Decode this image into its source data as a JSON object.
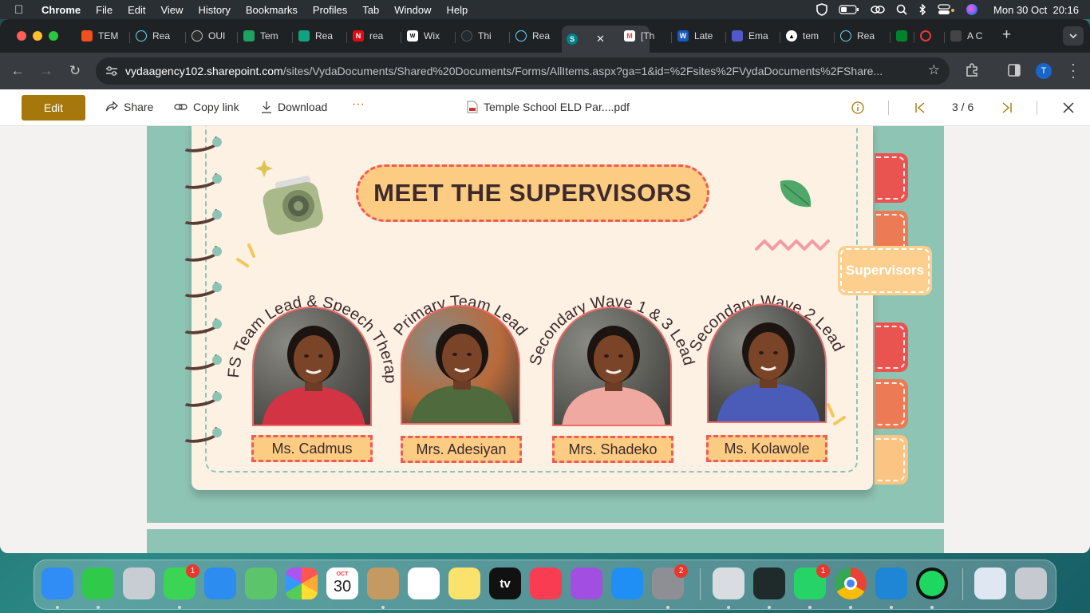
{
  "menubar": {
    "apple_icon": "apple-icon",
    "app_name": "Chrome",
    "menus": [
      "File",
      "Edit",
      "View",
      "History",
      "Bookmarks",
      "Profiles",
      "Tab",
      "Window",
      "Help"
    ],
    "clock": "Mon 30 Oct  20:16"
  },
  "browser": {
    "tabs": [
      {
        "label": "TEM",
        "icon": "figma-icon",
        "color": "#f24e1e"
      },
      {
        "label": "Rea",
        "icon": "react-icon",
        "color": "#61dafb"
      },
      {
        "label": "OUI",
        "icon": "circle-half-icon",
        "color": "#2c2c2c"
      },
      {
        "label": "Tem",
        "icon": "sheets-icon",
        "color": "#1ca261"
      },
      {
        "label": "Rea",
        "icon": "chatgpt-icon",
        "color": "#10a37f"
      },
      {
        "label": "rea",
        "icon": "netflix-icon",
        "color": "#e50914"
      },
      {
        "label": "Wix",
        "icon": "wix-icon",
        "color": "#ffffff"
      },
      {
        "label": "Thi",
        "icon": "github-icon",
        "color": "#24292e"
      },
      {
        "label": "Rea",
        "icon": "react-icon",
        "color": "#61dafb"
      },
      {
        "label": "",
        "icon": "sharepoint-icon",
        "color": "#038387",
        "active": true
      },
      {
        "label": "[Th",
        "icon": "gmail-icon",
        "color": "#ea4335"
      },
      {
        "label": "Late",
        "icon": "word-icon",
        "color": "#185abd"
      },
      {
        "label": "Ema",
        "icon": "teams-icon",
        "color": "#5059c9"
      },
      {
        "label": "tem",
        "icon": "vercel-icon",
        "color": "#000000"
      },
      {
        "label": "Rea",
        "icon": "react-icon",
        "color": "#61dafb"
      },
      {
        "label": "",
        "icon": "google-meet-icon",
        "color": "#00832d"
      },
      {
        "label": "",
        "icon": "record-icon",
        "color": "#e53935"
      },
      {
        "label": "A C",
        "icon": "openai-icon",
        "color": "#444444"
      }
    ],
    "new_tab_label": "+",
    "url_host": "vydaagency102.sharepoint.com",
    "url_path": "/sites/VydaDocuments/Shared%20Documents/Forms/AllItems.aspx?ga=1&id=%2Fsites%2FVydaDocuments%2FShare...",
    "profile_initial": "T"
  },
  "viewer": {
    "edit_label": "Edit",
    "share_label": "Share",
    "copy_link_label": "Copy link",
    "download_label": "Download",
    "more_label": "···",
    "file_name": "Temple School ELD Par....pdf",
    "page_indicator": "3 / 6"
  },
  "slide": {
    "title": "MEET THE SUPERVISORS",
    "side_tab_label": "Supervisors",
    "side_tab_colors": [
      "#e95450",
      "#ec7b55",
      "#e95450",
      "#ec7b55",
      "#fcc483"
    ],
    "supervisors": [
      {
        "role": "EYFS Team Lead & Speech Therapist",
        "name": "Ms. Cadmus",
        "photo_bg": "#5b5a55",
        "shirt": "#d23444"
      },
      {
        "role": "Primary Team Lead",
        "name": "Mrs. Adesiyan",
        "photo_bg": "#b86a3a",
        "shirt": "#4f6a3c"
      },
      {
        "role": "Secondary Wave 1 & 3 Lead",
        "name": "Mrs. Shadeko",
        "photo_bg": "#5d5e58",
        "shirt": "#f0a9a0"
      },
      {
        "role": "Secondary Wave 2 Lead",
        "name": "Ms. Kolawole",
        "photo_bg": "#4f504c",
        "shirt": "#4a5cb8"
      }
    ]
  },
  "dock": {
    "apps": [
      {
        "name": "Finder",
        "icon": "finder-icon",
        "color": "#2f8df5"
      },
      {
        "name": "FaceTime",
        "icon": "facetime-icon",
        "color": "#31c94a"
      },
      {
        "name": "Launchpad",
        "icon": "launchpad-icon",
        "color": "#c8cdd4"
      },
      {
        "name": "Messages",
        "icon": "messages-icon",
        "color": "#3bd454",
        "badge": "1"
      },
      {
        "name": "Mail",
        "icon": "mail-icon",
        "color": "#2d8cf0"
      },
      {
        "name": "Maps",
        "icon": "maps-icon",
        "color": "#5cc46a"
      },
      {
        "name": "Photos",
        "icon": "photos-icon",
        "color": "#ffffff"
      },
      {
        "name": "Calendar",
        "icon": "calendar-icon",
        "color": "#ffffff",
        "month": "OCT",
        "day": "30"
      },
      {
        "name": "Contacts",
        "icon": "contacts-icon",
        "color": "#c59a62"
      },
      {
        "name": "Reminders",
        "icon": "reminders-icon",
        "color": "#ffffff"
      },
      {
        "name": "Notes",
        "icon": "notes-icon",
        "color": "#fbe26d"
      },
      {
        "name": "TV",
        "icon": "appletv-icon",
        "color": "#111111",
        "text": "tv"
      },
      {
        "name": "Music",
        "icon": "music-icon",
        "color": "#fa3c52"
      },
      {
        "name": "Podcasts",
        "icon": "podcasts-icon",
        "color": "#a24ee0"
      },
      {
        "name": "App Store",
        "icon": "appstore-icon",
        "color": "#1f8ff5"
      },
      {
        "name": "System Settings",
        "icon": "settings-icon",
        "color": "#8d8f94",
        "badge": "2"
      },
      {
        "name": "Preview",
        "icon": "preview-icon",
        "color": "#d9dde2"
      },
      {
        "name": "Activity Monitor",
        "icon": "activity-monitor-icon",
        "color": "#1f2a2a"
      },
      {
        "name": "WhatsApp",
        "icon": "whatsapp-icon",
        "color": "#25d366",
        "badge": "1"
      },
      {
        "name": "Chrome",
        "icon": "chrome-icon",
        "color": "#ffffff"
      },
      {
        "name": "VS Code",
        "icon": "vscode-icon",
        "color": "#1f86d6"
      },
      {
        "name": "Spotify",
        "icon": "spotify-icon",
        "color": "#1ed760"
      },
      {
        "name": "Downloads",
        "icon": "downloads-folder-icon",
        "color": "#dfe7f3"
      },
      {
        "name": "Trash",
        "icon": "trash-icon",
        "color": "#c6cad0"
      }
    ]
  }
}
